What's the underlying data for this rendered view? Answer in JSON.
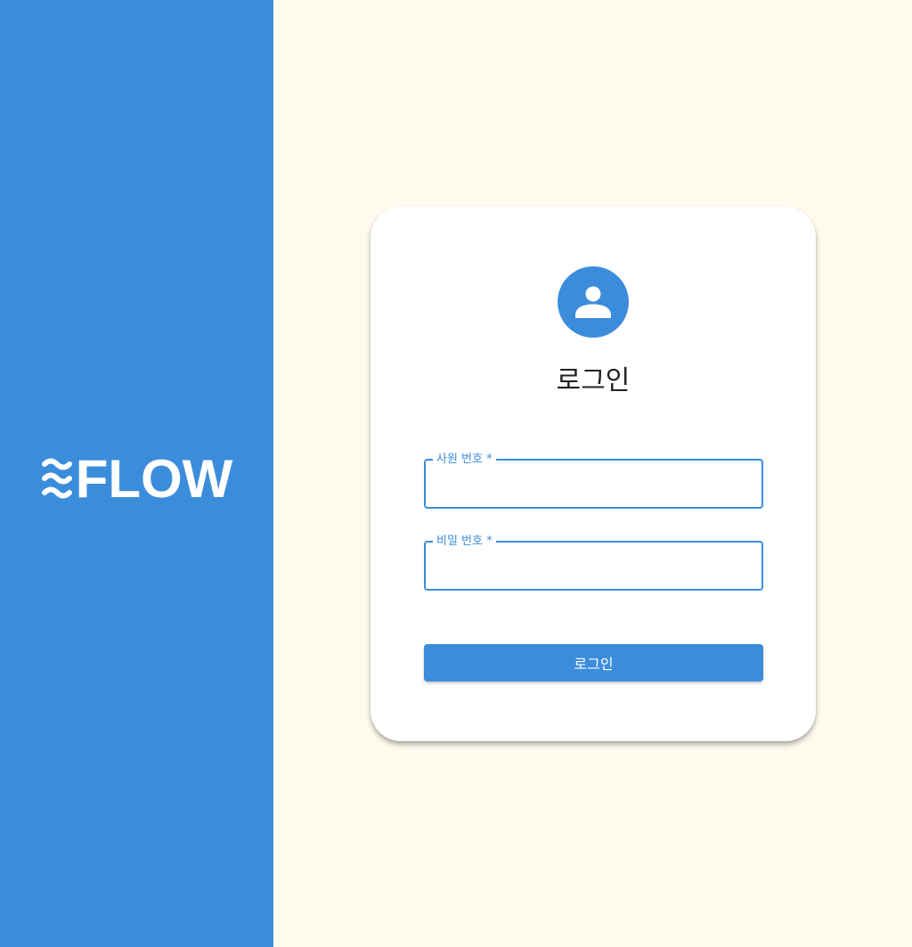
{
  "brand": {
    "name": "FLOW",
    "mark_icon": "wave-icon",
    "panel_color": "#3b8ddb"
  },
  "login": {
    "avatar_icon": "person-icon",
    "title": "로그인",
    "fields": [
      {
        "label": "사원 번호 *",
        "value": "",
        "type": "text"
      },
      {
        "label": "비밀 번호 *",
        "value": "",
        "type": "password"
      }
    ],
    "submit_label": "로그인"
  },
  "colors": {
    "accent": "#3b8ddb",
    "background": "#fefaee",
    "card": "#ffffff"
  }
}
